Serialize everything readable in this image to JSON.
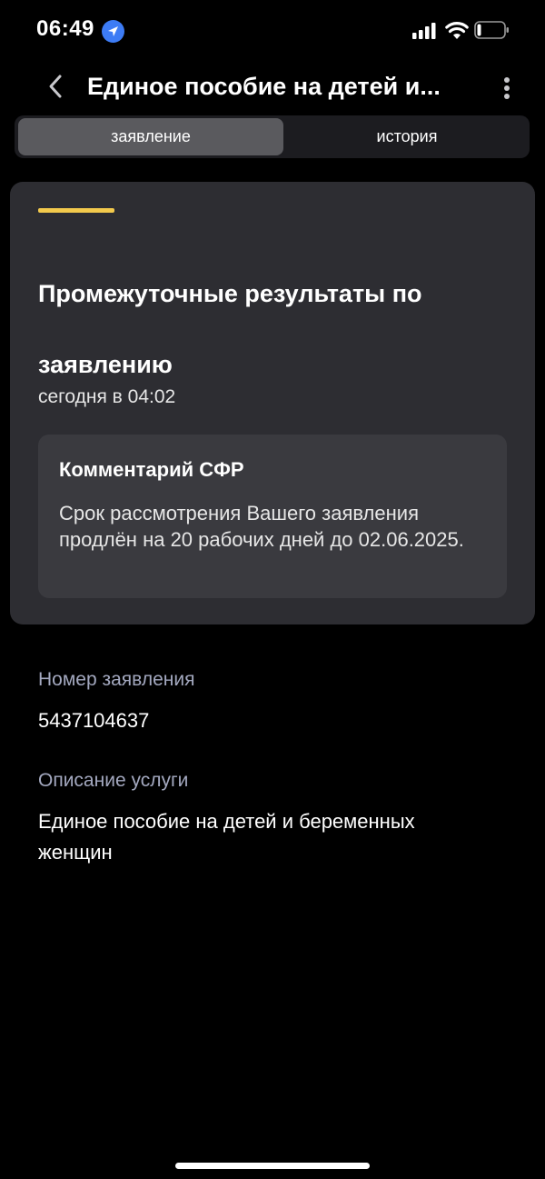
{
  "status_bar": {
    "time": "06:49",
    "icons": [
      "location-arrow-icon",
      "cellular-signal-icon",
      "wifi-icon",
      "battery-icon"
    ]
  },
  "header": {
    "back_icon": "chevron-left-icon",
    "title": "Единое пособие на детей и...",
    "more_icon": "vertical-ellipsis-icon"
  },
  "tabs": [
    {
      "label": "заявление",
      "selected": true
    },
    {
      "label": "история",
      "selected": false
    }
  ],
  "card": {
    "title": "Промежуточные результаты по заявлению",
    "date": "сегодня в 04:02",
    "comment": {
      "title": "Комментарий СФР",
      "text": "Срок рассмотрения Вашего заявления продлён на 20 рабочих дней до 02.06.2025."
    }
  },
  "details": {
    "application_number_label": "Номер заявления",
    "application_number": "5437104637",
    "service_description_label": "Описание услуги",
    "service_description": "Единое пособие на детей и беременных женщин"
  },
  "colors": {
    "background": "#000000",
    "card": "#2d2d32",
    "accent": "#f2c94c",
    "location_badge": "#3d7cf5",
    "label": "#a3a8bf"
  }
}
